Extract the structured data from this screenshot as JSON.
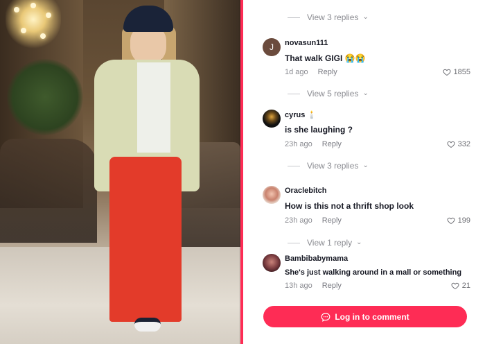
{
  "photo": {
    "subject": ""
  },
  "comments": {
    "view_replies": [
      {
        "label": "View 3 replies"
      },
      {
        "label": "View 5 replies"
      },
      {
        "label": "View 3 replies"
      },
      {
        "label": "View 1 reply"
      }
    ],
    "items": [
      {
        "username": "novasun111",
        "text": "That walk GIGI 😭😭",
        "time": "1d ago",
        "reply_label": "Reply",
        "likes": "1855",
        "avatar_letter": "J",
        "avatar_color": "#6b4b3d"
      },
      {
        "username": "cyrus 🕯️",
        "text": "is she laughing ?",
        "time": "23h ago",
        "reply_label": "Reply",
        "likes": "332",
        "avatar_letter": "",
        "avatar_color": "#1a1a1a"
      },
      {
        "username": "Oraclebitch",
        "text": "How is this not a thrift shop look",
        "time": "23h ago",
        "reply_label": "Reply",
        "likes": "199",
        "avatar_letter": "",
        "avatar_color": "#d9917c"
      },
      {
        "username": "Bambibabymama",
        "text": "She's just walking around in a mall or something",
        "time": "13h ago",
        "reply_label": "Reply",
        "likes": "21",
        "avatar_letter": "",
        "avatar_color": "#7a3b3f"
      }
    ],
    "login_label": "Log in to comment"
  },
  "colors": {
    "accent": "#fe2c55",
    "muted": "#8a8b91"
  },
  "icons": {
    "heart": "heart-outline-icon",
    "chevron": "chevron-down-icon",
    "comment": "comment-bubble-icon"
  }
}
